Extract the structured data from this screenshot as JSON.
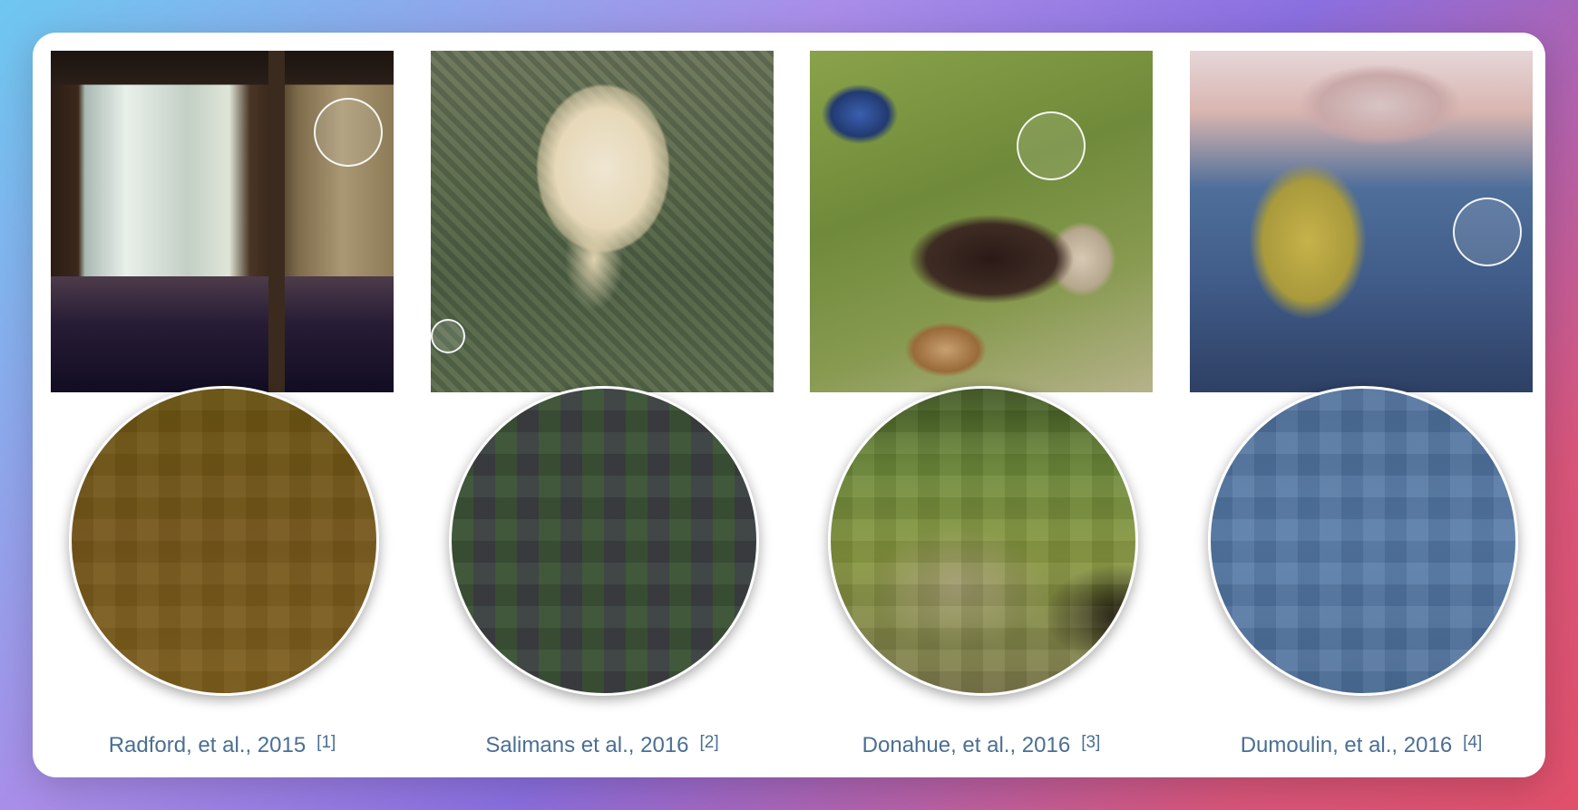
{
  "panels": [
    {
      "image": "room-scene-image",
      "caption": "Radford, et al., 2015",
      "citation": "[1]",
      "magnified_color": "#74581a"
    },
    {
      "image": "monkey-scene-image",
      "caption": "Salimans et al., 2016",
      "citation": "[2]",
      "magnified_color": "#3e4a3c"
    },
    {
      "image": "creature-scene-image",
      "caption": "Donahue, et al., 2016",
      "citation": "[3]",
      "magnified_color": "#7e8a3e"
    },
    {
      "image": "abstract-scene-image",
      "caption": "Dumoulin, et al., 2016",
      "citation": "[4]",
      "magnified_color": "#5076a0"
    }
  ]
}
